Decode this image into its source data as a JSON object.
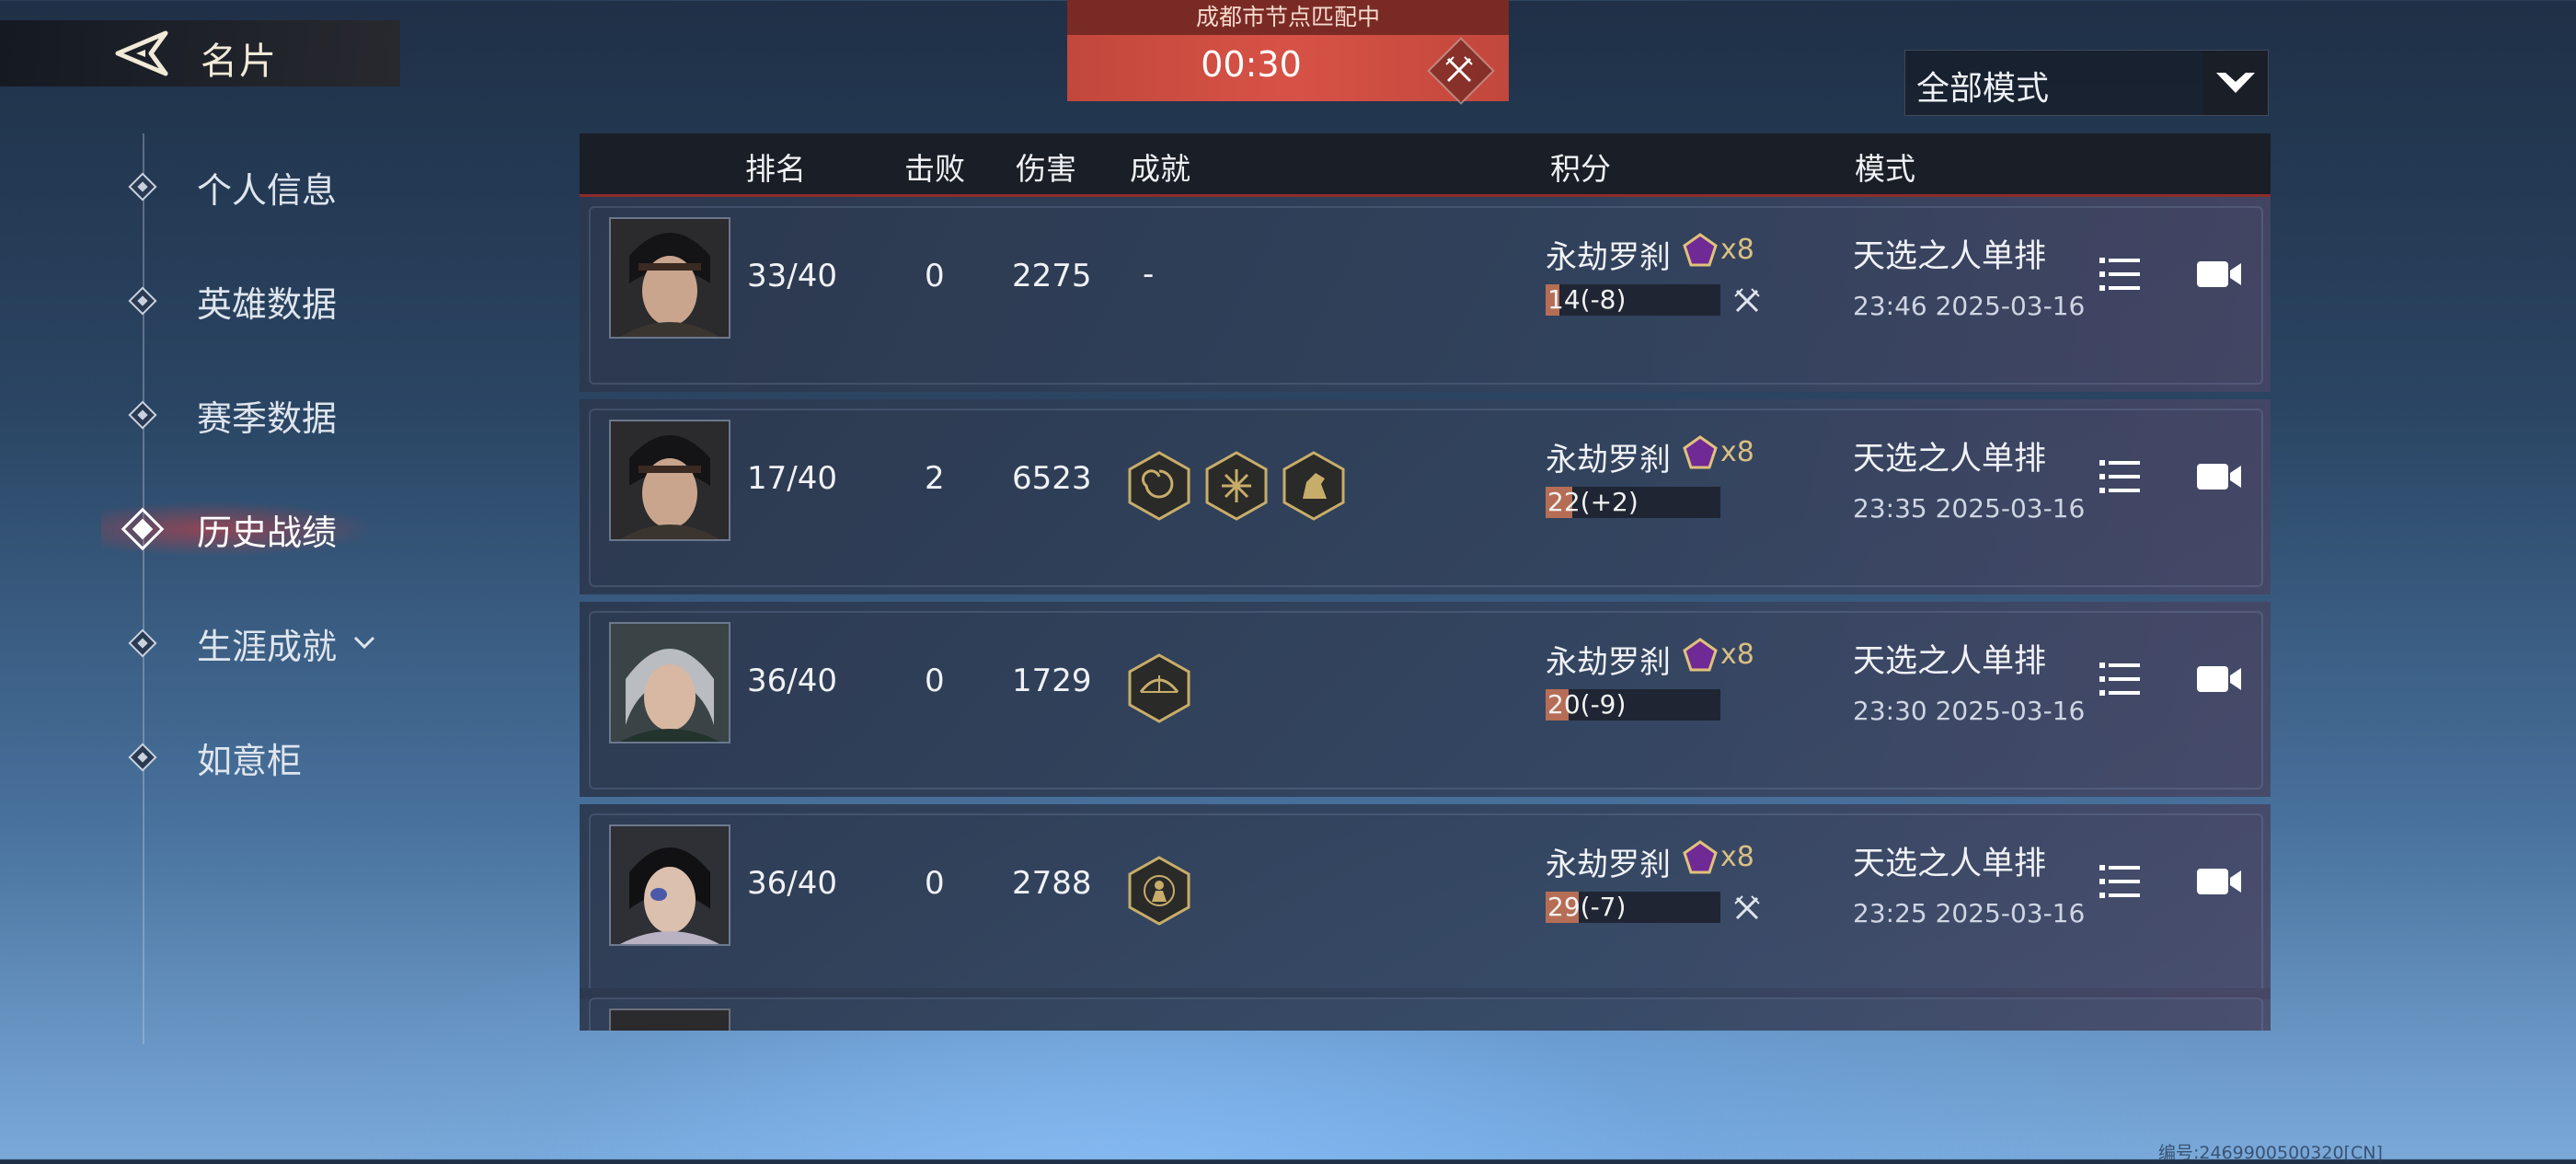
{
  "header": {
    "title": "名片"
  },
  "match": {
    "status": "成都市节点匹配中",
    "timer": "00:30"
  },
  "mode_select": {
    "value": "全部模式"
  },
  "sidebar": {
    "items": [
      {
        "label": "个人信息"
      },
      {
        "label": "英雄数据"
      },
      {
        "label": "赛季数据"
      },
      {
        "label": "历史战绩",
        "active": true
      },
      {
        "label": "生涯成就"
      },
      {
        "label": "如意柜"
      }
    ]
  },
  "table": {
    "headers": {
      "rank": "排名",
      "kills": "击败",
      "damage": "伤害",
      "achievements": "成就",
      "score": "积分",
      "mode": "模式"
    },
    "rows": [
      {
        "rank": "33/40",
        "kills": "0",
        "damage": "2275",
        "achievements_text": "-",
        "achievements": [],
        "tier": "永劫罗刹",
        "gem_count": "x8",
        "score_main": "1",
        "score_sub": "4(-8)",
        "score_fill": 0.08,
        "defeated": true,
        "mode": "天选之人单排",
        "time": "23:46  2025-03-16"
      },
      {
        "rank": "17/40",
        "kills": "2",
        "damage": "6523",
        "achievements_text": "",
        "achievements": [
          "spiral-badge-icon",
          "burst-badge-icon",
          "horse-badge-icon"
        ],
        "tier": "永劫罗刹",
        "gem_count": "x8",
        "score_main": "22",
        "score_sub": "(+2)",
        "score_fill": 0.15,
        "defeated": false,
        "mode": "天选之人单排",
        "time": "23:35  2025-03-16"
      },
      {
        "rank": "36/40",
        "kills": "0",
        "damage": "1729",
        "achievements_text": "",
        "achievements": [
          "bow-badge-icon"
        ],
        "tier": "永劫罗刹",
        "gem_count": "x8",
        "score_main": "20",
        "score_sub": "(-9)",
        "score_fill": 0.13,
        "defeated": false,
        "mode": "天选之人单排",
        "time": "23:30  2025-03-16"
      },
      {
        "rank": "36/40",
        "kills": "0",
        "damage": "2788",
        "achievements_text": "",
        "achievements": [
          "figure-badge-icon"
        ],
        "tier": "永劫罗刹",
        "gem_count": "x8",
        "score_main": "29",
        "score_sub": "(-7)",
        "score_fill": 0.19,
        "defeated": true,
        "mode": "天选之人单排",
        "time": "23:25  2025-03-16"
      }
    ]
  },
  "footer": {
    "watermark": "编号:2469900500320[CN]"
  },
  "colors": {
    "accent_red": "#8e2c2a",
    "score_bar": "#b56e55",
    "gem_gold": "#d9c082",
    "gem_purple": "#7a2c9c"
  }
}
